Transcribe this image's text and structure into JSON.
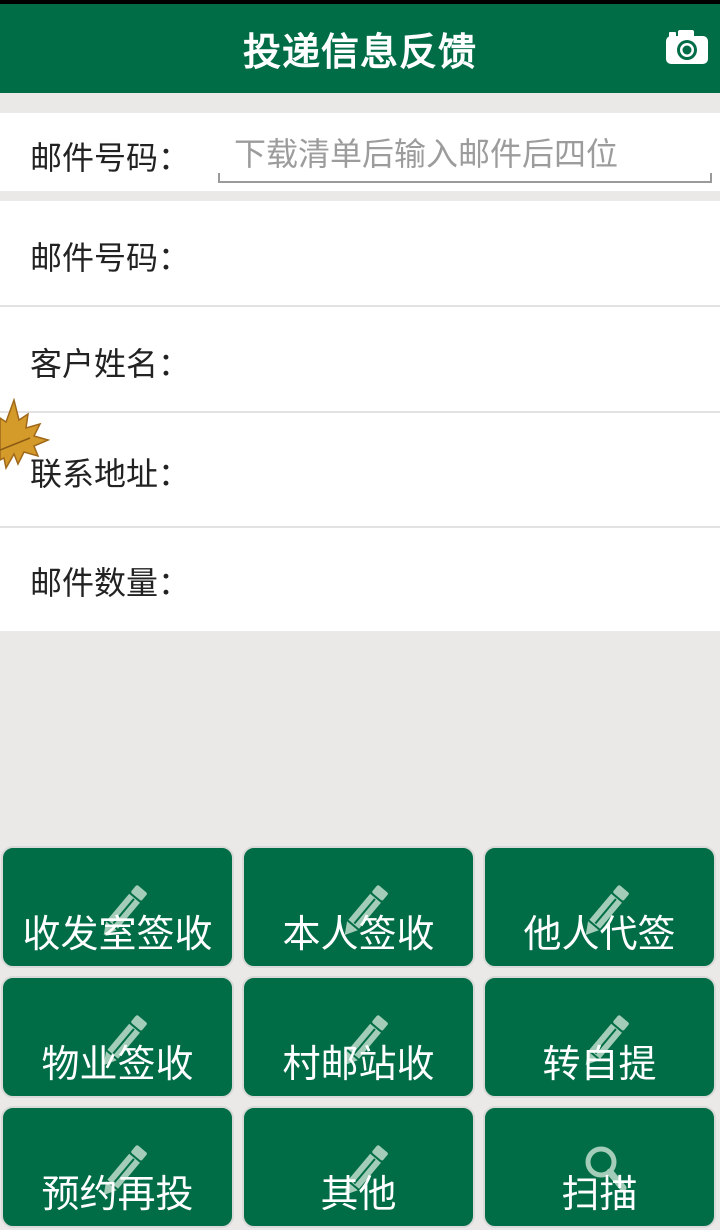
{
  "header": {
    "title": "投递信息反馈",
    "camera_icon": "camera-icon"
  },
  "search": {
    "label": "邮件号码：",
    "placeholder": "下载清单后输入邮件后四位",
    "value": ""
  },
  "details": {
    "mail_number_label": "邮件号码：",
    "customer_name_label": "客户姓名：",
    "address_label": "联系地址：",
    "mail_count_label": "邮件数量："
  },
  "actions": [
    {
      "label": "收发室签收",
      "icon": "pencil-icon"
    },
    {
      "label": "本人签收",
      "icon": "pencil-icon"
    },
    {
      "label": "他人代签",
      "icon": "pencil-icon"
    },
    {
      "label": "物业签收",
      "icon": "pencil-icon"
    },
    {
      "label": "村邮站收",
      "icon": "pencil-icon"
    },
    {
      "label": "转自提",
      "icon": "pencil-icon"
    },
    {
      "label": "预约再投",
      "icon": "pencil-icon"
    },
    {
      "label": "其他",
      "icon": "pencil-icon"
    },
    {
      "label": "扫描",
      "icon": "magnifier-icon"
    }
  ],
  "colors": {
    "primary": "#006d46",
    "background": "#ebe9e7",
    "button_border": "#d9d9d9",
    "icon_tint": "#a3cdb9"
  }
}
